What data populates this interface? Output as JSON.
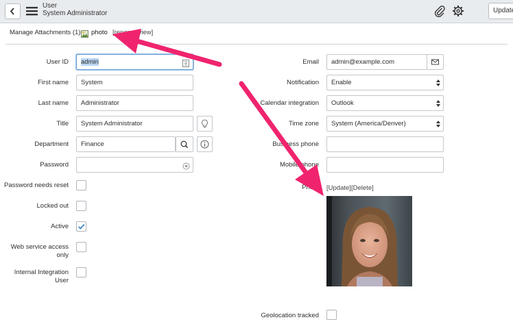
{
  "header": {
    "title_line1": "User",
    "title_line2": "System Administrator",
    "update_label": "Update",
    "icons": [
      "back-icon",
      "menu-icon",
      "paperclip-icon",
      "gear-icon"
    ]
  },
  "attachments": {
    "label": "Manage Attachments (1):",
    "file_name": "photo",
    "rename_link": "[rename]",
    "view_link": "[view]"
  },
  "form": {
    "left": [
      {
        "label": "User ID",
        "value": "admin"
      },
      {
        "label": "First name",
        "value": "System"
      },
      {
        "label": "Last name",
        "value": "Administrator"
      },
      {
        "label": "Title",
        "value": "System Administrator"
      },
      {
        "label": "Department",
        "value": "Finance"
      },
      {
        "label": "Password",
        "value": ""
      }
    ],
    "checkboxes": [
      {
        "label": "Password needs reset",
        "checked": false
      },
      {
        "label": "Locked out",
        "checked": false
      },
      {
        "label": "Active",
        "checked": true
      },
      {
        "label_line1": "Web service access",
        "label_line2": "only",
        "checked": false
      },
      {
        "label_line1": "Internal Integration",
        "label_line2": "User",
        "checked": false
      }
    ],
    "right": [
      {
        "label": "Email",
        "value": "admin@example.com"
      },
      {
        "label": "Notification",
        "value": "Enable"
      },
      {
        "label": "Calendar integration",
        "value": "Outlook"
      },
      {
        "label": "Time zone",
        "value": "System (America/Denver)"
      },
      {
        "label": "Business phone",
        "value": ""
      },
      {
        "label": "Mobile phone",
        "value": ""
      }
    ],
    "photo_label": "Photo",
    "photo_update_link": "[Update]",
    "photo_delete_link": "[Delete]",
    "geolocation_label": "Geolocation tracked"
  },
  "colors": {
    "arrow": "#f0246e",
    "header_bg": "#e9ecef",
    "checkmark": "#3b82c4"
  }
}
